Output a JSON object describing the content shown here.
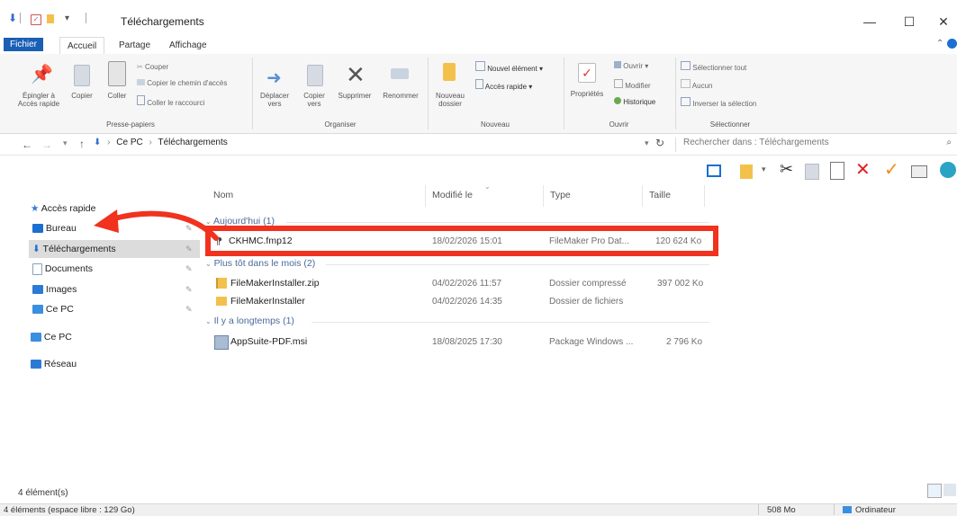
{
  "window": {
    "title": "Téléchargements",
    "controls": {
      "minimize": "—",
      "maximize": "☐",
      "close": "✕"
    }
  },
  "ribbon_tabs": [
    "Fichier",
    "Accueil",
    "Partage",
    "Affichage"
  ],
  "ribbon": {
    "pin": "Épingler à Accès rapide",
    "copy": "Copier",
    "paste": "Coller",
    "cut": "Couper",
    "copy_path": "Copier le chemin d'accès",
    "paste_shortcut": "Coller le raccourci",
    "group_clipboard": "Presse-papiers",
    "move_to": "Déplacer vers",
    "copy_to": "Copier vers",
    "delete": "Supprimer",
    "rename": "Renommer",
    "group_organize": "Organiser",
    "new_folder": "Nouveau dossier",
    "new_item": "Nouvel élément",
    "easy_access": "Accès rapide",
    "group_new": "Nouveau",
    "properties": "Propriétés",
    "open": "Ouvrir",
    "edit": "Modifier",
    "history": "Historique",
    "group_open": "Ouvrir",
    "select_all": "Sélectionner tout",
    "select_none": "Aucun",
    "invert_selection": "Inverser la sélection",
    "group_select": "Sélectionner"
  },
  "address": {
    "path": [
      "Ce PC",
      "Téléchargements"
    ],
    "search_placeholder": "Rechercher dans : Téléchargements"
  },
  "nav": {
    "quick_access": "Accès rapide",
    "items": [
      {
        "label": "Bureau",
        "color": "#1a6fd1"
      },
      {
        "label": "Téléchargements",
        "color": "#1a6fd1"
      },
      {
        "label": "Documents",
        "color": "#8aa0b8"
      },
      {
        "label": "Images",
        "color": "#2d7ad6"
      },
      {
        "label": "Ce PC",
        "color": "#3a8fe0"
      }
    ],
    "this_pc": "Ce PC",
    "network": "Réseau"
  },
  "columns": {
    "name": "Nom",
    "modified": "Modifié le",
    "type": "Type",
    "size": "Taille"
  },
  "groups": [
    {
      "label": "Aujourd'hui (1)",
      "files": [
        {
          "name": "CKHMC.fmp12",
          "modified": "18/02/2026 15:01",
          "type": "FileMaker Pro Dat...",
          "size": "120 624 Ko"
        }
      ]
    },
    {
      "label": "Plus tôt dans le mois (2)",
      "files": [
        {
          "name": "FileMakerInstaller.zip",
          "modified": "04/02/2026 11:57",
          "type": "Dossier compressé",
          "size": "397 002 Ko"
        },
        {
          "name": "FileMakerInstaller",
          "modified": "04/02/2026 14:35",
          "type": "Dossier de fichiers",
          "size": ""
        }
      ]
    },
    {
      "label": "Il y a longtemps (1)",
      "files": [
        {
          "name": "AppSuite-PDF.msi",
          "modified": "18/08/2025 17:30",
          "type": "Package Windows ...",
          "size": "2 796 Ko"
        }
      ]
    }
  ],
  "status": {
    "count": "4 élément(s)",
    "free_space": "4 éléments (espace libre : 129 Go)",
    "size": "508 Mo",
    "computer": "Ordinateur"
  },
  "colors": {
    "highlight": "#f0321e",
    "accent": "#1a5fb4",
    "selected_bg": "#dcdcdc"
  }
}
